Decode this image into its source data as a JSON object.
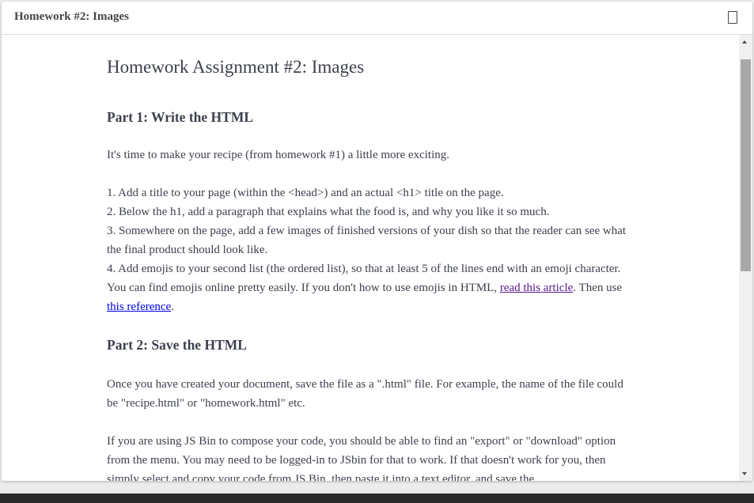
{
  "modal": {
    "title": "Homework #2: Images"
  },
  "content": {
    "page_title": "Homework Assignment #2: Images",
    "part1": {
      "heading": "Part 1: Write the HTML",
      "intro": "It's time to make your recipe (from homework #1) a little more exciting.",
      "item1": "1. Add a title to your page (within the <head>) and an actual <h1> title on the page.",
      "item2": "2. Below the h1, add a paragraph that explains what the food is, and why you like it so much.",
      "item3": "3. Somewhere on the page, add a few images of finished versions of your dish so that the reader can see what the final product should look like.",
      "item4_pre": "4. Add emojis to your second list (the ordered list), so that at least 5 of the lines end with an emoji character. You can find emojis online pretty easily. If you don't how to use emojis in HTML, ",
      "link_read_article": "read this article",
      "item4_mid": ". Then use ",
      "link_reference": "this reference",
      "item4_end": "."
    },
    "part2": {
      "heading": "Part 2: Save the HTML",
      "para1": "Once you have created your document, save the file as a \".html\" file. For example, the name of the file could be \"recipe.html\" or \"homework.html\" etc.",
      "para2": "If you are using JS Bin to compose your code, you should be able to find an \"export\" or \"download\" option from the menu. You may need to be logged-in to JSbin for that to work. If that doesn't work for you, then simply select and copy your code from JS Bin, then paste it into a text editor, and save the"
    }
  },
  "colors": {
    "link": "#0000ee",
    "link_visited": "#551a8b",
    "text": "#3d414d",
    "scroll_thumb": "#a8a8a8"
  },
  "icons": {
    "maximize": "maximize-icon",
    "scroll_up": "arrow-up-icon",
    "scroll_down": "arrow-down-icon"
  }
}
